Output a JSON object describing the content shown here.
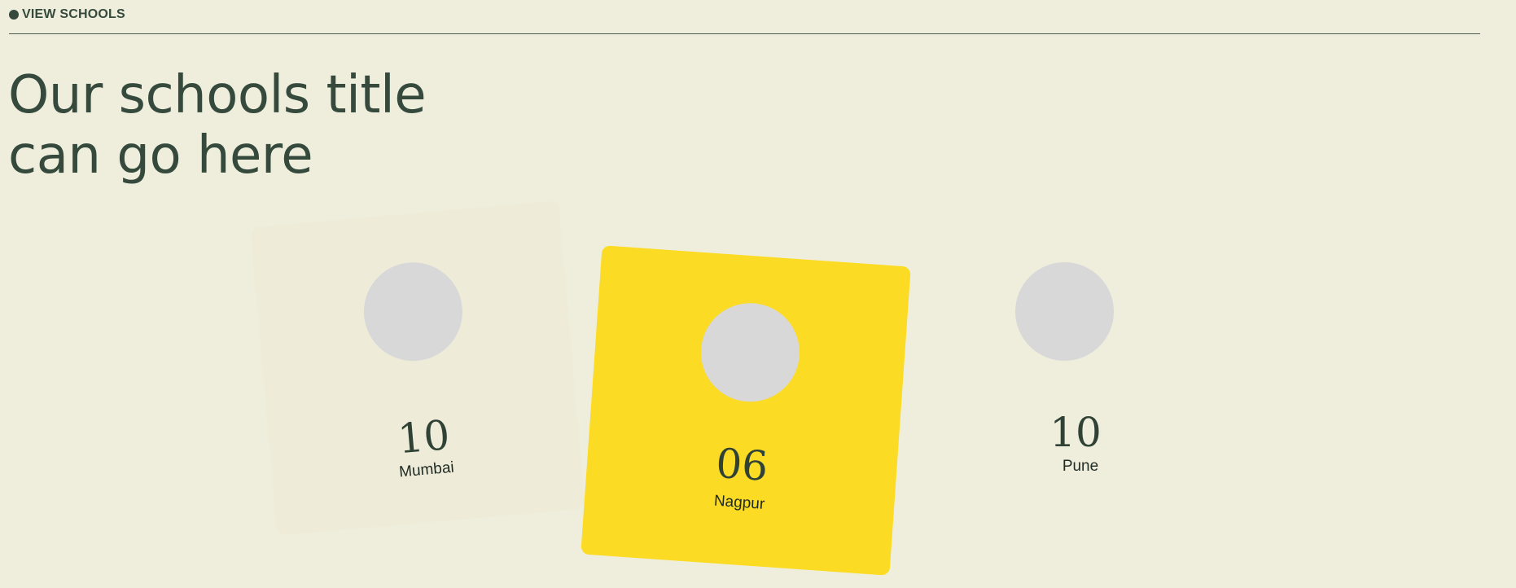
{
  "header": {
    "view_link": "VIEW SCHOOLS"
  },
  "title": {
    "line1": "Our schools title",
    "line2": "can go here"
  },
  "schools": [
    {
      "count": "10",
      "city": "Mumbai"
    },
    {
      "count": "06",
      "city": "Nagpur"
    },
    {
      "count": "10",
      "city": "Pune"
    }
  ],
  "colors": {
    "background": "#efeedd",
    "text": "#354a3c",
    "active_card": "#fbdb24",
    "placeholder": "#d8d8d8"
  }
}
